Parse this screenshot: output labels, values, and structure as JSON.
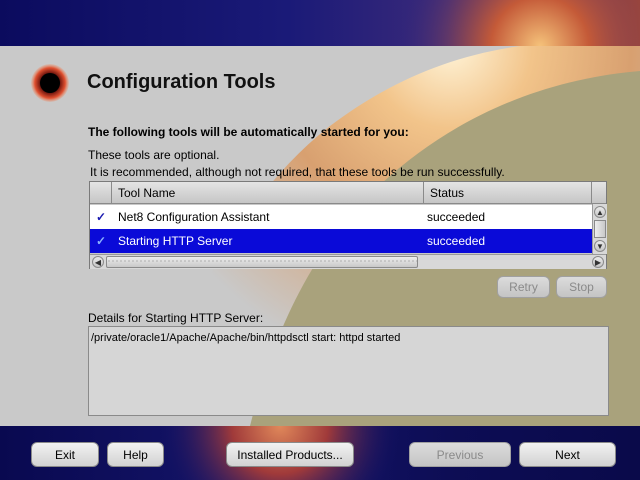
{
  "header": {
    "title": "Configuration Tools"
  },
  "intro": {
    "heading": "The following tools will be automatically started for you:",
    "line1": "These tools are optional.",
    "line2": "It is recommended, although not required, that these tools be run successfully."
  },
  "table": {
    "columns": [
      "Tool Name",
      "Status"
    ],
    "rows": [
      {
        "check": "✓",
        "name": "Net8 Configuration Assistant",
        "status": "succeeded",
        "selected": false
      },
      {
        "check": "✓",
        "name": "Starting HTTP Server",
        "status": "succeeded",
        "selected": true
      }
    ]
  },
  "actions": {
    "retry": "Retry",
    "stop": "Stop"
  },
  "details": {
    "label": "Details for Starting HTTP Server:",
    "text": "/private/oracle1/Apache/Apache/bin/httpdsctl start: httpd started"
  },
  "footer": {
    "exit": "Exit",
    "help": "Help",
    "installed_products": "Installed Products...",
    "previous": "Previous",
    "next": "Next"
  },
  "colors": {
    "selection": "#0a0ad8",
    "check": "#1a1ab0",
    "accent_sun": "#e8a060",
    "olive": "#a9a27c"
  }
}
